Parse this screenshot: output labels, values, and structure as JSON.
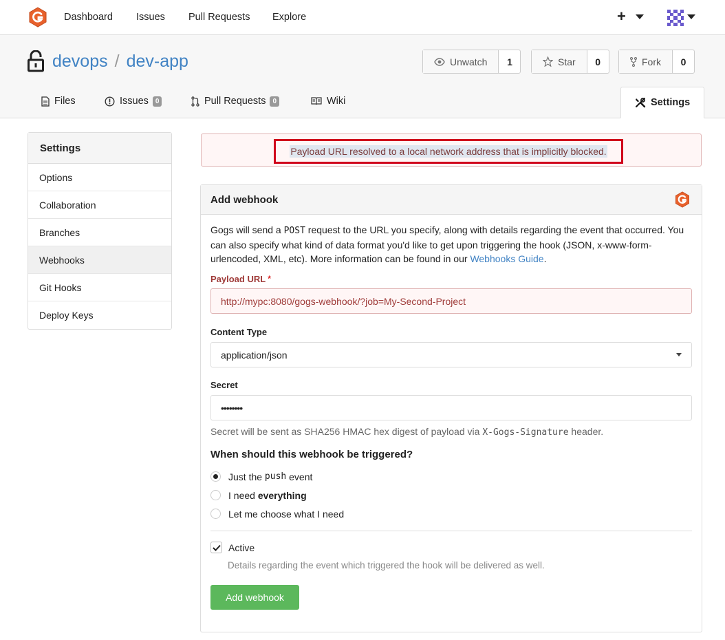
{
  "topnav": {
    "logo_icon": "gogs-logo-icon",
    "items": [
      "Dashboard",
      "Issues",
      "Pull Requests",
      "Explore"
    ],
    "plus": "+",
    "avatar_icon": "user-avatar-icon"
  },
  "repo": {
    "owner": "devops",
    "separator": "/",
    "name": "dev-app",
    "lock_icon": "lock-icon",
    "watch": {
      "label": "Unwatch",
      "count": "1",
      "icon": "eye-icon"
    },
    "star": {
      "label": "Star",
      "count": "0",
      "icon": "star-icon"
    },
    "fork": {
      "label": "Fork",
      "count": "0",
      "icon": "fork-icon"
    }
  },
  "tabs": [
    {
      "label": "Files",
      "icon": "file-icon"
    },
    {
      "label": "Issues",
      "badge": "0",
      "icon": "issue-icon"
    },
    {
      "label": "Pull Requests",
      "badge": "0",
      "icon": "pull-request-icon"
    },
    {
      "label": "Wiki",
      "icon": "book-icon"
    },
    {
      "label": "Settings",
      "icon": "tools-icon",
      "active": true
    }
  ],
  "sidebar": {
    "title": "Settings",
    "items": [
      "Options",
      "Collaboration",
      "Branches",
      "Webhooks",
      "Git Hooks",
      "Deploy Keys"
    ],
    "active": "Webhooks"
  },
  "error": {
    "message": "Payload URL resolved to a local network address that is implicitly blocked."
  },
  "form": {
    "title": "Add webhook",
    "desc_1": "Gogs will send a ",
    "desc_post": "POST",
    "desc_2": " request to the URL you specify, along with details regarding the event that occurred. You can also specify what kind of data format you'd like to get upon triggering the hook (JSON, x-www-form-urlencoded, XML, etc). More information can be found in our ",
    "desc_link": "Webhooks Guide",
    "desc_end": ".",
    "payload_label": "Payload URL",
    "payload_required": "*",
    "payload_value": "http://mypc:8080/gogs-webhook/?job=My-Second-Project",
    "content_type_label": "Content Type",
    "content_type_value": "application/json",
    "secret_label": "Secret",
    "secret_value": "••••••••",
    "secret_help_1": "Secret will be sent as SHA256 HMAC hex digest of payload via ",
    "secret_help_code": "X-Gogs-Signature",
    "secret_help_2": " header.",
    "trigger_title": "When should this webhook be triggered?",
    "trigger_push_1": "Just the ",
    "trigger_push_code": "push",
    "trigger_push_2": " event",
    "trigger_all_1": "I need ",
    "trigger_all_bold": "everything",
    "trigger_choose": "Let me choose what I need",
    "trigger_selected": "push",
    "active_label": "Active",
    "active_checked": true,
    "active_help": "Details regarding the event which triggered the hook will be delivered as well.",
    "submit": "Add webhook"
  },
  "colors": {
    "link": "#4183c4",
    "error_bg": "#fff6f6",
    "error_border": "#e0b4b4",
    "error_text": "#9f3a38",
    "highlight_border": "#d0021b",
    "primary": "#5cb85c",
    "gogs_orange": "#e8612c"
  }
}
